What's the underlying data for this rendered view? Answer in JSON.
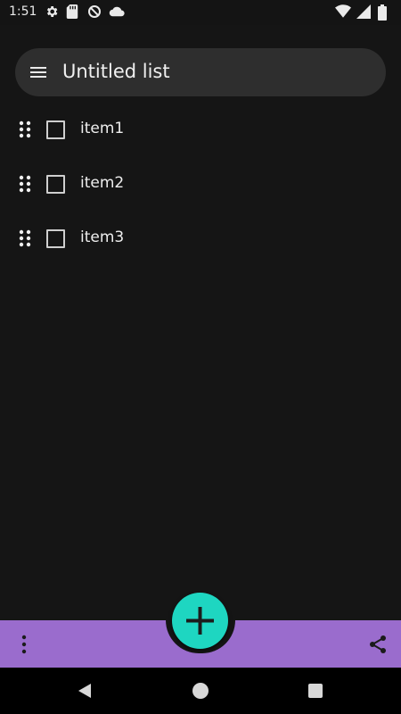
{
  "status_bar": {
    "time": "1:51",
    "left_icons": [
      "settings-icon",
      "sd-card-icon",
      "no-sync-icon",
      "cloud-icon"
    ],
    "right_icons": [
      "wifi-icon",
      "signal-icon",
      "battery-icon"
    ]
  },
  "header": {
    "title": "Untitled list",
    "menu_icon": "hamburger-menu-icon"
  },
  "list": {
    "items": [
      {
        "label": "item1",
        "checked": false
      },
      {
        "label": "item2",
        "checked": false
      },
      {
        "label": "item3",
        "checked": false
      }
    ]
  },
  "bottom_bar": {
    "color": "#9a6ccd",
    "left_icon": "more-vert-icon",
    "right_icon": "share-icon"
  },
  "fab": {
    "icon": "plus-icon",
    "color": "#1ed6c1"
  },
  "nav_bar": {
    "icons": [
      "back-icon",
      "home-icon",
      "recents-icon"
    ]
  }
}
